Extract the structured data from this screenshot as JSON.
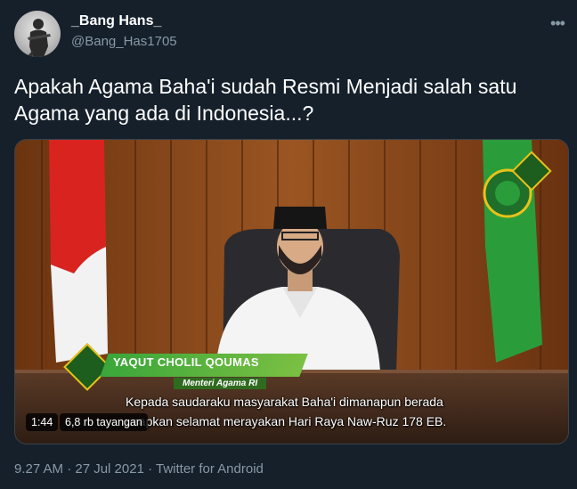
{
  "user": {
    "display_name": "_Bang Hans_",
    "handle": "@Bang_Has1705"
  },
  "tweet": {
    "text": "Apakah Agama Baha'i sudah Resmi Menjadi salah satu Agama yang ada di Indonesia...?"
  },
  "video": {
    "lower_third_name": "YAQUT CHOLIL QOUMAS",
    "lower_third_title": "Menteri Agama RI",
    "subtitle_line1": "Kepada saudaraku masyarakat Baha'i dimanapun berada",
    "subtitle_line2": "ucapkan selamat merayakan Hari Raya Naw-Ruz 178 EB.",
    "duration": "1:44",
    "views": "6,8 rb tayangan"
  },
  "meta": {
    "timestamp": "9.27 AM · 27 Jul 2021 · Twitter for Android"
  },
  "icons": {
    "more": "more-horizontal-icon",
    "lt_logo": "ministry-logo-icon"
  },
  "colors": {
    "background": "#15202b",
    "text_primary": "#ffffff",
    "text_secondary": "#8899a6",
    "border": "#38444d",
    "accent_green": "#3aa63a"
  }
}
